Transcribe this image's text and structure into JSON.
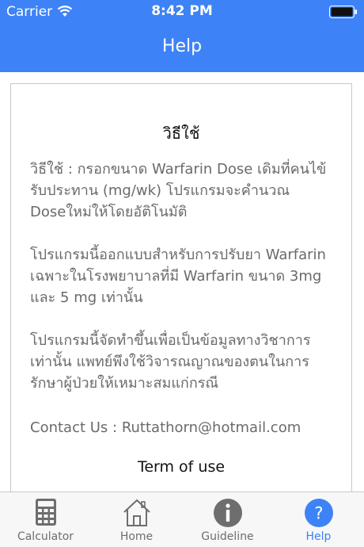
{
  "status_bar": {
    "carrier": "Carrier",
    "time": "8:42 PM",
    "wifi_icon": "wifi-icon",
    "battery_icon": "battery-icon"
  },
  "nav": {
    "title": "Help"
  },
  "card": {
    "title": "วิธีใช้",
    "paragraphs": [
      "วิธีใช้ : กรอกขนาด Warfarin Dose เดิมที่คนไข้รับประทาน (mg/wk) โปรแกรมจะคำนวณ Doseใหม่ให้โดยอัติโนมัติ",
      "โปรแกรมนี้ออกแบบสำหรับการปรับยา Warfarin เฉพาะในโรงพยาบาลที่มี Warfarin ขนาด 3mg และ 5 mg เท่านั้น",
      "โปรแกรมนี้จัดทำขึ้นเพื่อเป็นข้อมูลทางวิชาการเท่านั้น แพทย์พึงใช้วิจารณญาณของตนในการรักษาผู้ป่วยให้เหมาะสมแก่กรณี",
      "Contact Us : Ruttathorn@hotmail.com"
    ],
    "term_link": "Term of use"
  },
  "tabs": [
    {
      "label": "Calculator",
      "icon": "calculator-icon",
      "active": false
    },
    {
      "label": "Home",
      "icon": "home-icon",
      "active": false
    },
    {
      "label": "Guideline",
      "icon": "info-icon",
      "active": false
    },
    {
      "label": "Help",
      "icon": "help-icon",
      "active": true
    }
  ],
  "colors": {
    "accent": "#3d83f7",
    "tab_inactive": "#6e6e6e",
    "text_body": "#6a6a6a"
  }
}
